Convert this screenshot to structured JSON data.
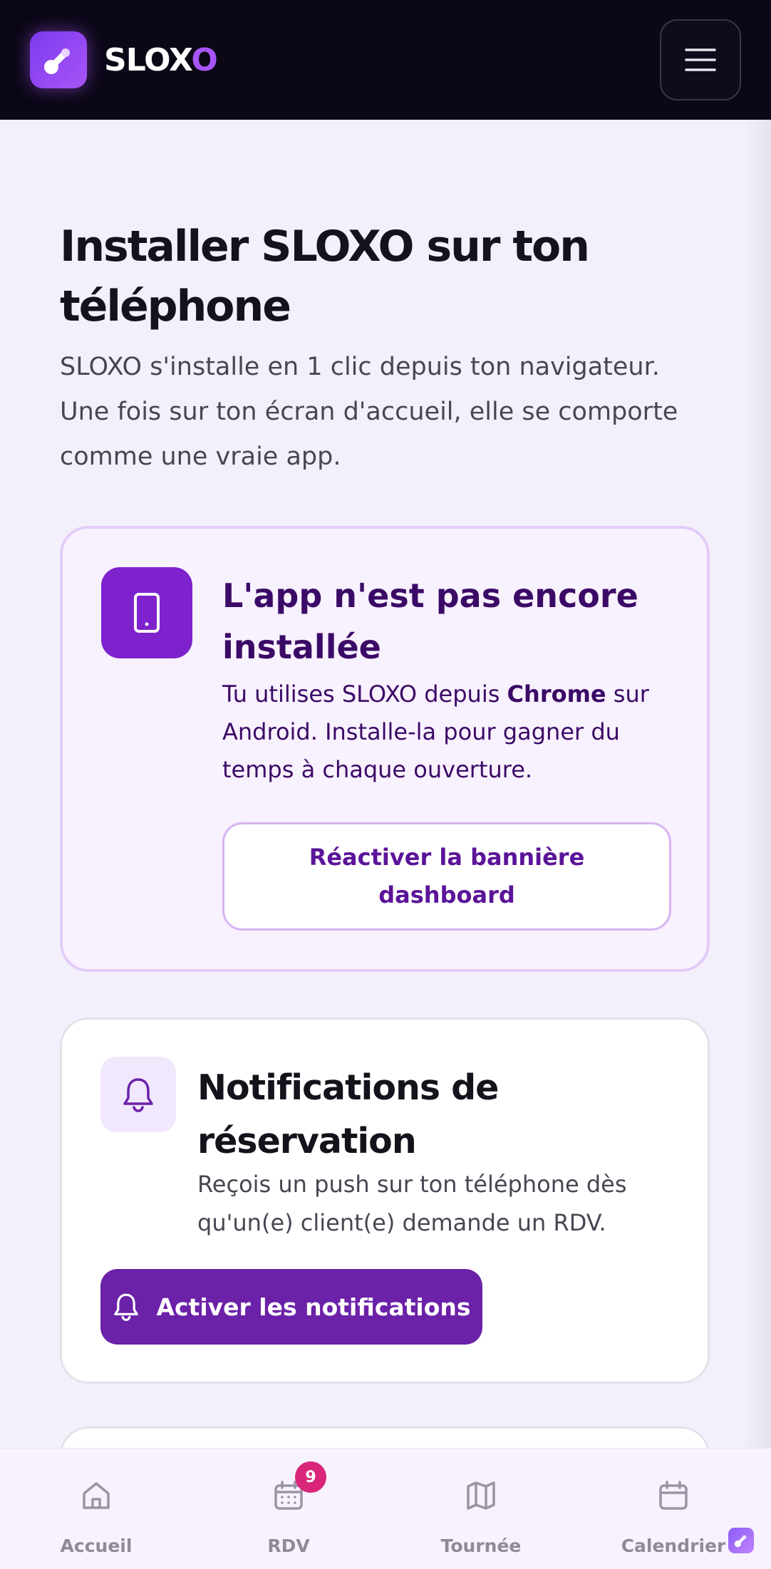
{
  "header": {
    "brand_prefix": "SLOX",
    "brand_suffix": "O",
    "logo_icon": "sloxo-logo-icon",
    "menu_icon": "hamburger-menu-icon"
  },
  "page": {
    "title": "Installer SLOXO sur ton téléphone",
    "intro": "SLOXO s'installe en 1 clic depuis ton navigateur. Une fois sur ton écran d'accueil, elle se comporte comme une vraie app."
  },
  "install_card": {
    "icon": "smartphone-icon",
    "title": "L'app n'est pas encore installée",
    "text_before": "Tu utilises SLOXO depuis ",
    "browser": "Chrome",
    "text_after": " sur Android. Installe-la pour gagner du temps à chaque ouverture.",
    "button_label": "Réactiver la bannière dashboard"
  },
  "notifications_card": {
    "icon": "bell-icon",
    "title": "Notifications de réservation",
    "text": "Reçois un push sur ton téléphone dès qu'un(e) client(e) demande un RDV.",
    "button_label": "Activer les notifications"
  },
  "bottom_nav": {
    "items": [
      {
        "label": "Accueil",
        "icon": "home-icon"
      },
      {
        "label": "RDV",
        "icon": "calendar-grid-icon",
        "badge": "9"
      },
      {
        "label": "Tournée",
        "icon": "map-icon"
      },
      {
        "label": "Calendrier",
        "icon": "calendar-icon"
      }
    ]
  },
  "colors": {
    "header_bg": "#0b0716",
    "accent": "#7e22ce",
    "button_primary": "#6b21a8",
    "badge": "#d9267a"
  }
}
